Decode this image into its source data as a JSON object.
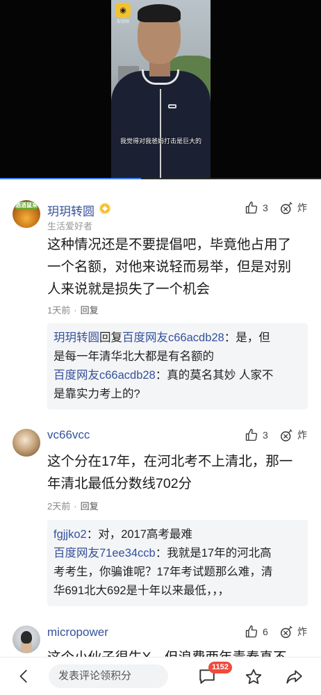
{
  "video": {
    "watermark_text": "梨视频",
    "subtitle": "我觉得对我爸妈打击是巨大的",
    "progress": 0.44
  },
  "comments": [
    {
      "username": "玥玥转圆",
      "user_tag": "生活爱好者",
      "avatar_badge": "酒酒鼠来",
      "like_count": "3",
      "boom_label": "炸",
      "text": [
        "这种情况还是不要提倡吧，毕竟他占用了",
        "一个名额，对他来说轻而易举，但是对别",
        "人来说就是损失了一个机会"
      ],
      "time": "1天前",
      "reply_label": "回复",
      "replies": [
        {
          "author": "玥玥转圆",
          "mid": "回复",
          "target": "百度网友c66acdb28",
          "line1": "：是，但",
          "line2": "是每一年清华北大都是有名额的"
        },
        {
          "author": "百度网友c66acdb28",
          "line1": "：真的莫名其妙 人家不",
          "line2": "是靠实力考上的?"
        }
      ]
    },
    {
      "username": "vc66vcc",
      "like_count": "3",
      "boom_label": "炸",
      "text": [
        "这个分在17年，在河北考不上清北，那一",
        "年清北最低分数线702分"
      ],
      "time": "2天前",
      "reply_label": "回复",
      "replies": [
        {
          "author": "fgjjko2",
          "line1": "：对，2017高考最难"
        },
        {
          "author": "百度网友71ee34ccb",
          "line1": "：我就是17年的河北高",
          "line2": "考考生，你骗谁呢？17年考试题那么难，清",
          "line3": "华691北大692是十年以来最低，，，"
        }
      ]
    },
    {
      "username": "micropower",
      "like_count": "6",
      "boom_label": "炸",
      "text": [
        "这个小伙子很牛X，但浪费两年青春真不"
      ]
    }
  ],
  "bottom": {
    "compose_placeholder": "发表评论领积分",
    "comment_count": "1152"
  },
  "colors": {
    "link": "#34519b",
    "badge": "#f04a3c"
  }
}
